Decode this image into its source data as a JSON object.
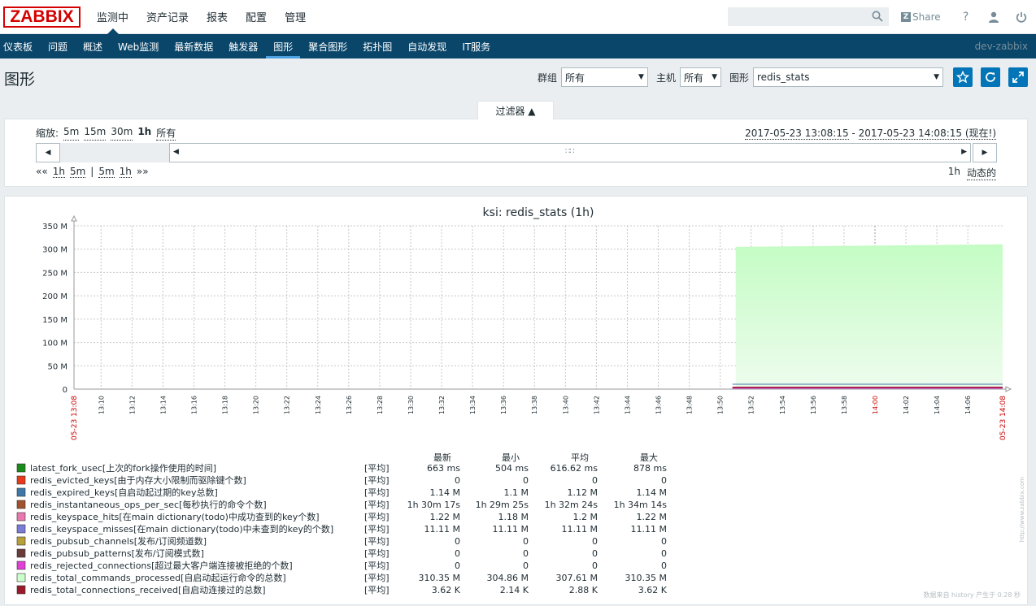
{
  "header": {
    "logo": "ZABBIX",
    "nav": [
      "监测中",
      "资产记录",
      "报表",
      "配置",
      "管理"
    ],
    "active_nav": "监测中",
    "share_label": "Share",
    "help_label": "?"
  },
  "subnav": {
    "items": [
      "仪表板",
      "问题",
      "概述",
      "Web监测",
      "最新数据",
      "触发器",
      "图形",
      "聚合图形",
      "拓扑图",
      "自动发现",
      "IT服务"
    ],
    "active": "图形",
    "server": "dev-zabbix"
  },
  "page": {
    "title": "图形",
    "group_label": "群组",
    "group_value": "所有",
    "host_label": "主机",
    "host_value": "所有",
    "graph_label": "图形",
    "graph_value": "redis_stats"
  },
  "filter": {
    "tab_label": "过滤器 ▲",
    "zoom_label": "缩放:",
    "zoom_options": [
      "5m",
      "15m",
      "30m",
      "1h",
      "所有"
    ],
    "zoom_active": "1h",
    "period_from": "2017-05-23 13:08:15",
    "period_sep": " - ",
    "period_to": "2017-05-23 14:08:15 (现在!)",
    "step_back": "««",
    "step_back_options": [
      "1h",
      "5m"
    ],
    "step_sep": "|",
    "step_fwd_options": [
      "5m",
      "1h"
    ],
    "step_fwd": "»»",
    "period_length": "1h",
    "dynamic_label": "动态的"
  },
  "chart_data": {
    "type": "area",
    "title": "ksi: redis_stats (1h)",
    "yunit": "M",
    "ylim": [
      0,
      350
    ],
    "yticks": [
      "350 M",
      "300 M",
      "250 M",
      "200 M",
      "150 M",
      "100 M",
      "50 M",
      "0"
    ],
    "x_start_label": "05-23 13:08",
    "x_end_label": "05-23 14:08",
    "xticks": [
      "13:10",
      "13:12",
      "13:14",
      "13:16",
      "13:18",
      "13:20",
      "13:22",
      "13:24",
      "13:26",
      "13:28",
      "13:30",
      "13:32",
      "13:34",
      "13:36",
      "13:38",
      "13:40",
      "13:42",
      "13:44",
      "13:46",
      "13:48",
      "13:50",
      "13:52",
      "13:54",
      "13:56",
      "13:58",
      "14:00",
      "14:02",
      "14:04",
      "14:06"
    ],
    "highlight_ticks": [
      "14:00"
    ],
    "area_series": {
      "name": "redis_total_commands_processed",
      "start": "13:51",
      "end": "14:08",
      "from": 304.86,
      "to": 310.35,
      "color": "#ccffcc"
    },
    "legend_headers": [
      "最新",
      "最小",
      "平均",
      "最大"
    ],
    "legend": [
      {
        "color": "#1a8a1a",
        "name": "latest_fork_usec[上次的fork操作使用的时间]",
        "func": "[平均]",
        "last": "663 ms",
        "min": "504 ms",
        "avg": "616.62 ms",
        "max": "878 ms"
      },
      {
        "color": "#e8391e",
        "name": "redis_evicted_keys[由于内存大小限制而驱除键个数]",
        "func": "[平均]",
        "last": "0",
        "min": "0",
        "avg": "0",
        "max": "0"
      },
      {
        "color": "#3e78a8",
        "name": "redis_expired_keys[自启动起过期的key总数]",
        "func": "[平均]",
        "last": "1.14 M",
        "min": "1.1 M",
        "avg": "1.12 M",
        "max": "1.14 M"
      },
      {
        "color": "#a0522d",
        "name": "redis_instantaneous_ops_per_sec[每秒执行的命令个数]",
        "func": "[平均]",
        "last": "1h 30m 17s",
        "min": "1h 29m 25s",
        "avg": "1h 32m 24s",
        "max": "1h 34m 14s"
      },
      {
        "color": "#e878b0",
        "name": "redis_keyspace_hits[在main dictionary(todo)中成功查到的key个数]",
        "func": "[平均]",
        "last": "1.22 M",
        "min": "1.18 M",
        "avg": "1.2 M",
        "max": "1.22 M"
      },
      {
        "color": "#7b7bd8",
        "name": "redis_keyspace_misses[在main dictionary(todo)中未查到的key的个数]",
        "func": "[平均]",
        "last": "11.11 M",
        "min": "11.11 M",
        "avg": "11.11 M",
        "max": "11.11 M"
      },
      {
        "color": "#b8a038",
        "name": "redis_pubsub_channels[发布/订阅频道数]",
        "func": "[平均]",
        "last": "0",
        "min": "0",
        "avg": "0",
        "max": "0"
      },
      {
        "color": "#6b3a3a",
        "name": "redis_pubsub_patterns[发布/订阅模式数]",
        "func": "[平均]",
        "last": "0",
        "min": "0",
        "avg": "0",
        "max": "0"
      },
      {
        "color": "#e040d8",
        "name": "redis_rejected_connections[超过最大客户端连接被拒绝的个数]",
        "func": "[平均]",
        "last": "0",
        "min": "0",
        "avg": "0",
        "max": "0"
      },
      {
        "color": "#ccffcc",
        "name": "redis_total_commands_processed[自启动起运行命令的总数]",
        "func": "[平均]",
        "last": "310.35 M",
        "min": "304.86 M",
        "avg": "307.61 M",
        "max": "310.35 M"
      },
      {
        "color": "#9a1a2a",
        "name": "redis_total_connections_received[自启动连接过的总数]",
        "func": "[平均]",
        "last": "3.62 K",
        "min": "2.14 K",
        "avg": "2.88 K",
        "max": "3.62 K"
      }
    ],
    "footer_text": "数据来自 history 产生于 0.28 秒",
    "side_url": "http://www.zabbix.com"
  },
  "colors": {
    "brand": "#d40000",
    "nav_bg": "#0a466a",
    "accent": "#0275b8",
    "area": "#ccffcc",
    "highlight": "#cc0000"
  }
}
